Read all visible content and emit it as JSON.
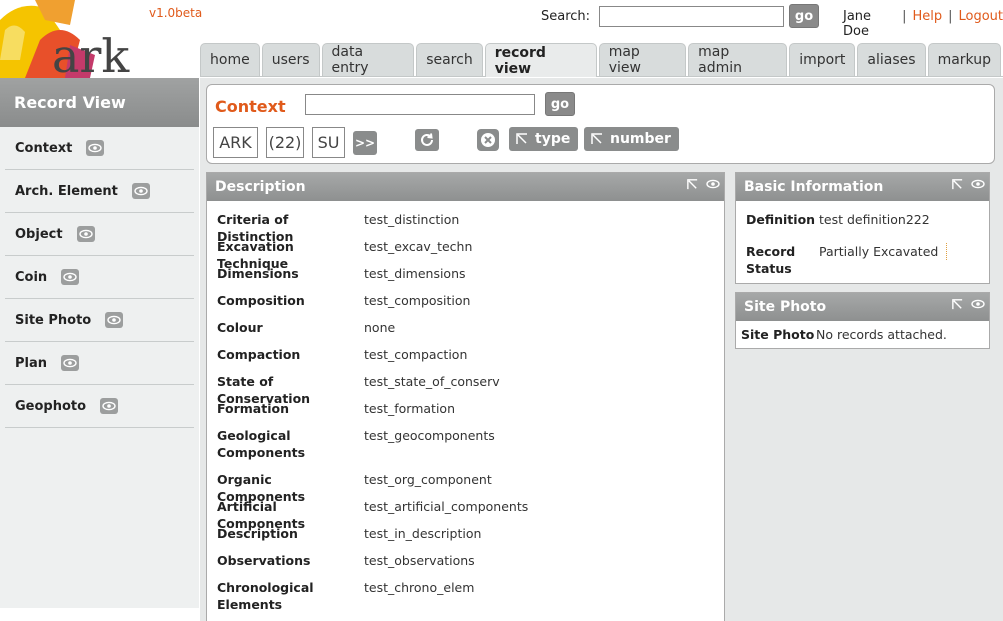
{
  "app": {
    "version": "v1.0beta",
    "logo_text": "ark"
  },
  "header": {
    "search_label": "Search:",
    "search_placeholder": "",
    "go_label": "go",
    "user_name": "Jane Doe",
    "separator": "|",
    "help_label": "Help",
    "logout_label": "Logout"
  },
  "tabs": [
    {
      "label": "home"
    },
    {
      "label": "users"
    },
    {
      "label": "data entry"
    },
    {
      "label": "search"
    },
    {
      "label": "record view",
      "active": true
    },
    {
      "label": "map view"
    },
    {
      "label": "map admin"
    },
    {
      "label": "import"
    },
    {
      "label": "aliases"
    },
    {
      "label": "markup"
    }
  ],
  "sidebar": {
    "title": "Record View",
    "items": [
      {
        "label": "Context"
      },
      {
        "label": "Arch. Element"
      },
      {
        "label": "Object"
      },
      {
        "label": "Coin"
      },
      {
        "label": "Site Photo"
      },
      {
        "label": "Plan"
      },
      {
        "label": "Geophoto"
      }
    ]
  },
  "context": {
    "label": "Context",
    "input_value": "",
    "go_label": "go",
    "ark_label": "ARK",
    "number_label": "(22)",
    "type_value": "SU",
    "next_label": ">>",
    "type_filter_label": "type",
    "number_filter_label": "number"
  },
  "description": {
    "title": "Description",
    "rows": [
      {
        "key": "Criteria of Distinction",
        "value": "test_distinction"
      },
      {
        "key": "Excavation Technique",
        "value": "test_excav_techn"
      },
      {
        "key": "Dimensions",
        "value": "test_dimensions"
      },
      {
        "key": "Composition",
        "value": "test_composition"
      },
      {
        "key": "Colour",
        "value": "none"
      },
      {
        "key": "Compaction",
        "value": "test_compaction"
      },
      {
        "key": "State of Conservation",
        "value": "test_state_of_conserv"
      },
      {
        "key": "Formation",
        "value": "test_formation"
      },
      {
        "key": "Geological Components",
        "value": "test_geocomponents"
      },
      {
        "key": "Organic Components",
        "value": "test_org_component"
      },
      {
        "key": "Artificial Components",
        "value": "test_artificial_components"
      },
      {
        "key": "Description",
        "value": "test_in_description"
      },
      {
        "key": "Observations",
        "value": "test_observations"
      },
      {
        "key": "Chronological Elements",
        "value": "test_chrono_elem"
      }
    ]
  },
  "basic_info": {
    "title": "Basic Information",
    "definition_label": "Definition",
    "definition_value": "test definition222",
    "status_label": "Record Status",
    "status_value": "Partially Excavated"
  },
  "site_photo": {
    "title": "Site Photo",
    "label": "Site Photo",
    "value": "No records attached."
  },
  "colors": {
    "accent": "#e05a1b",
    "header_grey": "#8e9090",
    "panel_bg": "#e6e8e8"
  }
}
